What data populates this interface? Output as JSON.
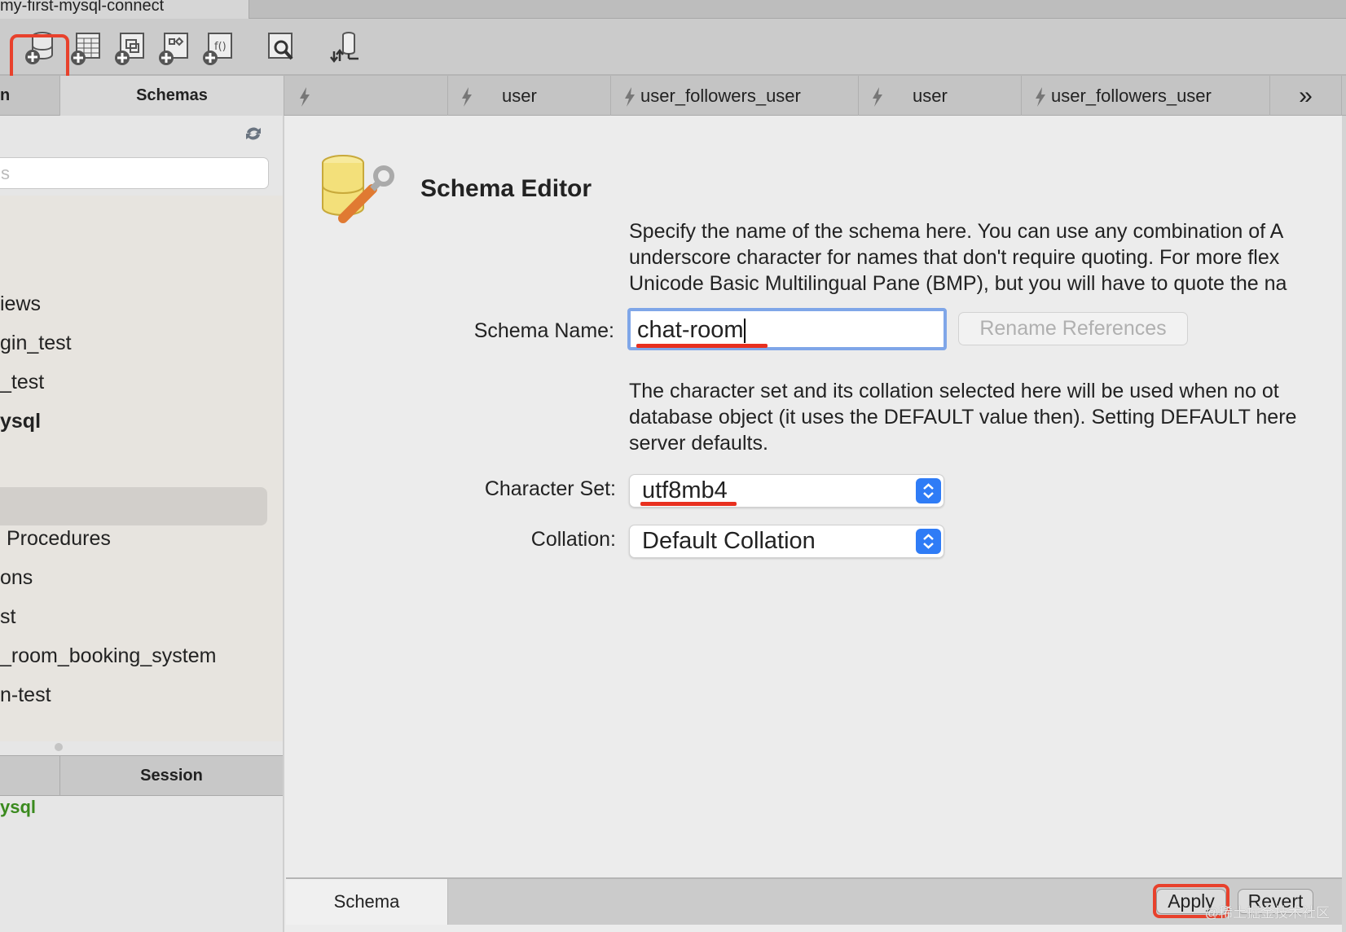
{
  "window": {
    "connection_tab": "my-first-mysql-connect"
  },
  "sidebar": {
    "tabs": [
      "n",
      "Schemas"
    ],
    "search_placeholder": "s",
    "items": [
      "iews",
      "gin_test",
      "_test",
      "ysql",
      "Procedures",
      "ons",
      "st",
      "_room_booking_system",
      "n-test"
    ],
    "selected_item": "ysql",
    "session_tabs": [
      "",
      "Session"
    ],
    "session_value": "ysql"
  },
  "editor_tabs": [
    "",
    "user",
    "user_followers_user",
    "user",
    "user_followers_user"
  ],
  "more_tabs_label": "»",
  "editor": {
    "title": "Schema Editor",
    "name_help": [
      "Specify the name of the schema here. You can use any combination of A",
      "underscore character for names that don't require quoting. For more flex",
      "Unicode Basic Multilingual Pane (BMP), but you will have to quote the na"
    ],
    "schema_name_label": "Schema Name:",
    "schema_name_value": "chat-room",
    "rename_label": "Rename References",
    "charset_help": [
      "The character set and its collation selected here will be used when no ot",
      "database object (it uses the DEFAULT value then). Setting DEFAULT here",
      "server defaults."
    ],
    "charset_label": "Character Set:",
    "charset_value": "utf8mb4",
    "collation_label": "Collation:",
    "collation_value": "Default Collation"
  },
  "bottom": {
    "tab": "Schema",
    "apply": "Apply",
    "revert": "Revert",
    "watermark": "@稀土掘金技术社区"
  },
  "colors": {
    "accent": "#2f7cf6",
    "annotation": "#e8412c",
    "session_green": "#3a8a1e"
  }
}
